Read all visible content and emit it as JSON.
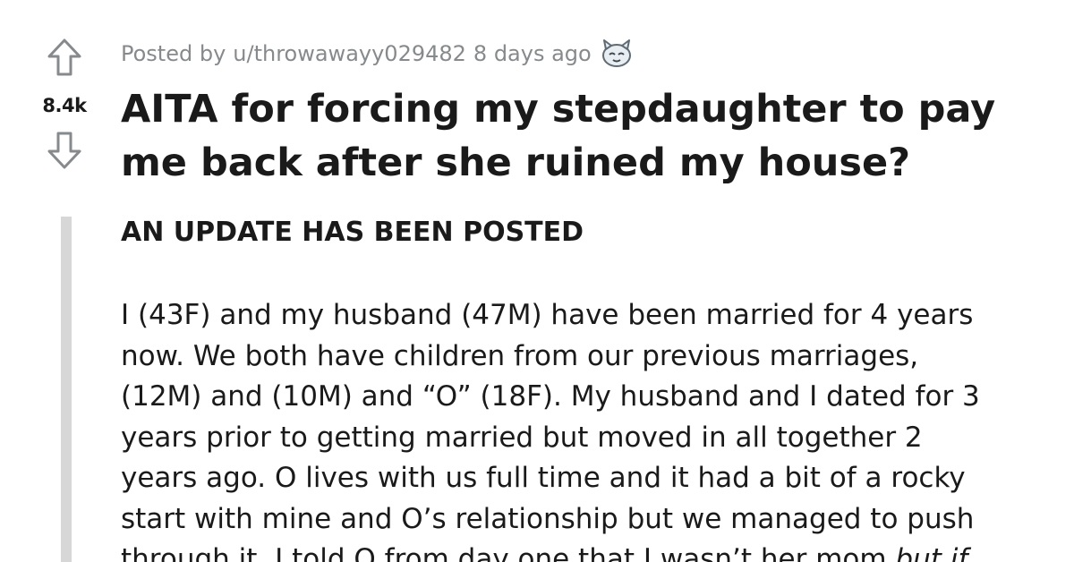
{
  "post": {
    "vote_count": "8.4k",
    "meta": {
      "posted_by_prefix": "Posted by",
      "username": "u/throwawayy029482",
      "time_ago": "8 days ago",
      "award_icon": "wholesome-award-icon"
    },
    "title_lines": [
      "AITA for forcing my stepdaughter to pay",
      "me back after she ruined my house?"
    ],
    "update_notice": "AN UPDATE HAS BEEN POSTED",
    "body_lines": [
      "I (43F) and my husband (47M) have been married for 4 years",
      "now. We both have children from our previous marriages,",
      "(12M) and (10M) and “O” (18F). My husband and I dated for 3",
      "years prior to getting married but moved in all together 2",
      "years ago. O lives with us full time and it had a bit of a rocky",
      "start with mine and O’s relationship but we managed to push",
      "through it. I told O from day one that I wasn’t her mom"
    ],
    "body_last_line_italic": "but if"
  },
  "colors": {
    "text": "#1a1a1b",
    "meta": "#878a8c",
    "quote_bar": "#d7d7d7",
    "vote_icon": "#878a8c"
  }
}
